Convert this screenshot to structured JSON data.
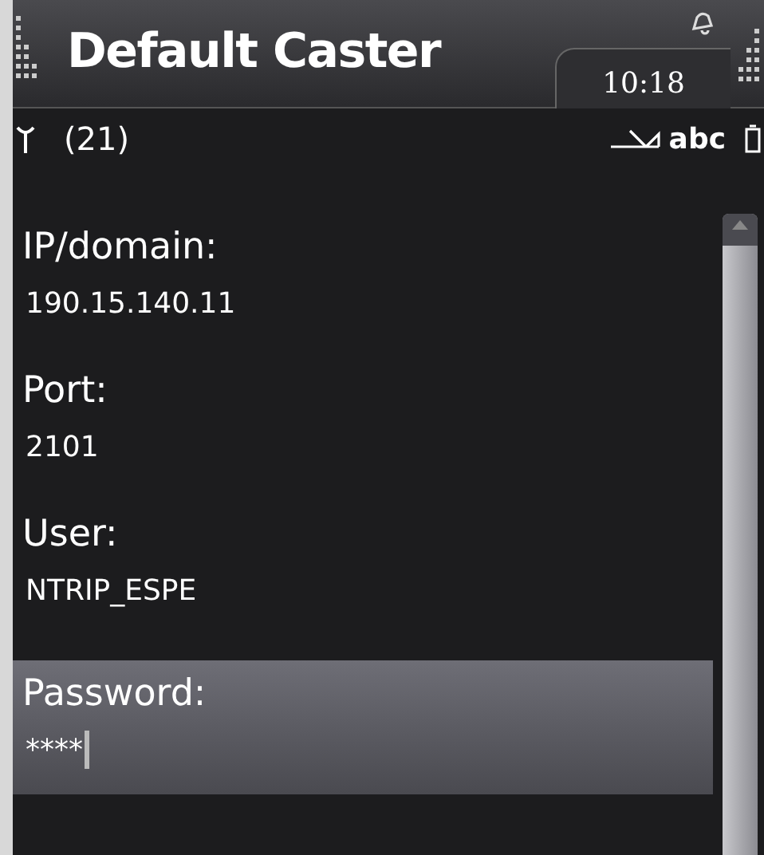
{
  "title_bar": {
    "title": "Default Caster",
    "clock": "10:18"
  },
  "status_bar": {
    "signal_count": "(21)",
    "input_mode": "abc"
  },
  "fields": [
    {
      "label": "IP/domain:",
      "value": "190.15.140.11",
      "selected": false
    },
    {
      "label": "Port:",
      "value": "2101",
      "selected": false
    },
    {
      "label": "User:",
      "value": "NTRIP_ESPE",
      "selected": false
    },
    {
      "label": "Password:",
      "value": "****",
      "selected": true
    }
  ]
}
